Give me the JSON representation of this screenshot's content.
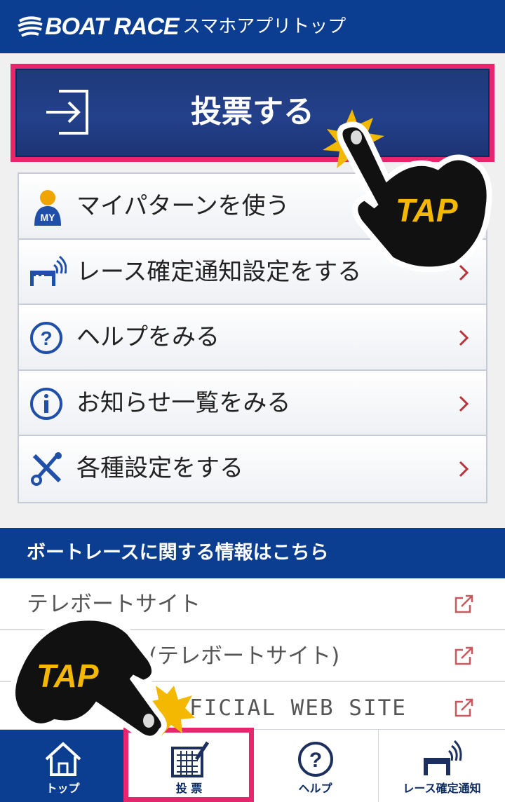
{
  "header": {
    "logo_text": "BOAT RACE",
    "subtitle": "スマホアプリトップ"
  },
  "vote_button": {
    "label": "投票する"
  },
  "menu": [
    {
      "label": "マイパターンを使う",
      "icon": "my-pattern-icon",
      "icon_text": "MY"
    },
    {
      "label": "レース確定通知設定をする",
      "icon": "race-notify-icon"
    },
    {
      "label": "ヘルプをみる",
      "icon": "help-icon"
    },
    {
      "label": "お知らせ一覧をみる",
      "icon": "info-icon"
    },
    {
      "label": "各種設定をする",
      "icon": "settings-icon"
    }
  ],
  "info_section": {
    "title": "ボートレースに関する情報はこちら"
  },
  "links": [
    {
      "label": "テレボートサイト"
    },
    {
      "label": "(テレボートサイト)"
    },
    {
      "label": "FICIAL WEB SITE"
    }
  ],
  "tabs": [
    {
      "label": "トップ",
      "icon": "home-icon",
      "active": true
    },
    {
      "label": "投 票",
      "icon": "vote-icon",
      "active": false
    },
    {
      "label": "ヘルプ",
      "icon": "help-icon",
      "active": false
    },
    {
      "label": "レース確定通知",
      "icon": "race-notify-icon",
      "active": false
    }
  ],
  "overlays": {
    "tap_text": "TAP"
  },
  "colors": {
    "brand_navy": "#0b3d91",
    "highlight_pink": "#e8266d",
    "tap_yellow": "#f5b800",
    "chevron_red": "#b8323a"
  }
}
